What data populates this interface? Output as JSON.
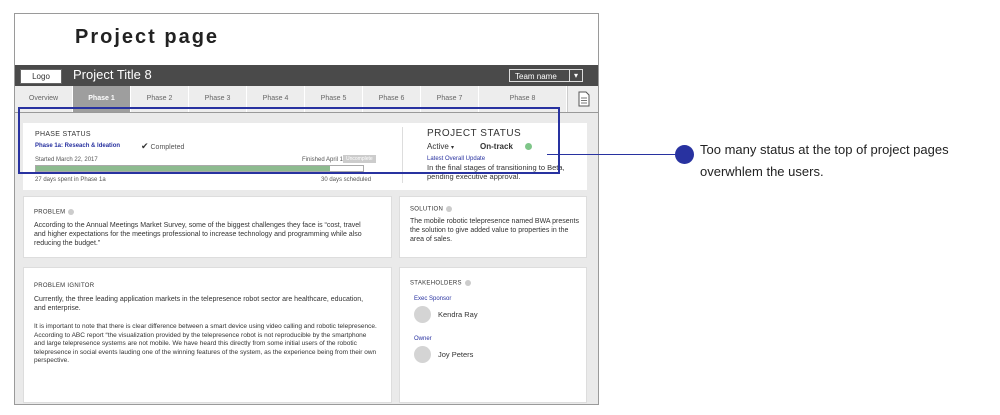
{
  "page": {
    "title": "Project page"
  },
  "topbar": {
    "logo": "Logo",
    "project_title": "Project Title 8",
    "team_name": "Team name",
    "caret": "▾"
  },
  "tabs": [
    "Overview",
    "Phase 1",
    "Phase 2",
    "Phase 3",
    "Phase 4",
    "Phase 5",
    "Phase 6",
    "Phase 7",
    "Phase 8"
  ],
  "phase_status": {
    "heading": "PHASE STATUS",
    "phase_name": "Phase 1a: Reseach & Ideation",
    "completed": "Completed",
    "started": "Started March 22, 2017",
    "finished": "Finished April 18, 2017",
    "badge": "Uncomplete",
    "progress_fraction": 0.9,
    "days_spent": "27 days spent in Phase 1a",
    "days_scheduled": "30 days scheduled"
  },
  "project_status": {
    "heading": "PROJECT STATUS",
    "active": "Active",
    "active_caret": "▾",
    "track": "On-track",
    "track_color": "#7fc689",
    "update_label": "Latest Overall Update",
    "update_text": "In the final stages of transitioning to Beta, pending executive approval."
  },
  "problem": {
    "heading": "PROBLEM",
    "text": "According to the Annual Meetings Market Survey, some of the biggest challenges they face is “cost, travel and higher expectations for the meetings professional to increase technology and programming while also reducing the budget.”"
  },
  "solution": {
    "heading": "SOLUTION",
    "text": "The mobile robotic telepresence named BWA presents the solution to give added value to properties in the area of sales."
  },
  "problem_ignitor": {
    "heading": "PROBLEM IGNITOR",
    "para1": "Currently, the three leading application markets in the telepresence robot sector are healthcare, education, and enterprise.",
    "para2": "It is important to note that there is clear difference between a smart device using video calling and robotic telepresence. According to ABC report “the visualization provided by the telepresence robot is not reproducible by the smartphone and large telepresence systems are not mobile. We have heard this directly from some initial users of the robotic telepresence in social events lauding one of the winning features of the system, as the experience being from their own perspective."
  },
  "stakeholders": {
    "heading": "STAKEHOLDERS",
    "exec_label": "Exec Sponsor",
    "exec_name": "Kendra Ray",
    "owner_label": "Owner",
    "owner_name": "Joy Peters"
  },
  "callout": {
    "text": "Too many status at the top of project pages overwhlem the users.",
    "color": "#2832a0"
  }
}
